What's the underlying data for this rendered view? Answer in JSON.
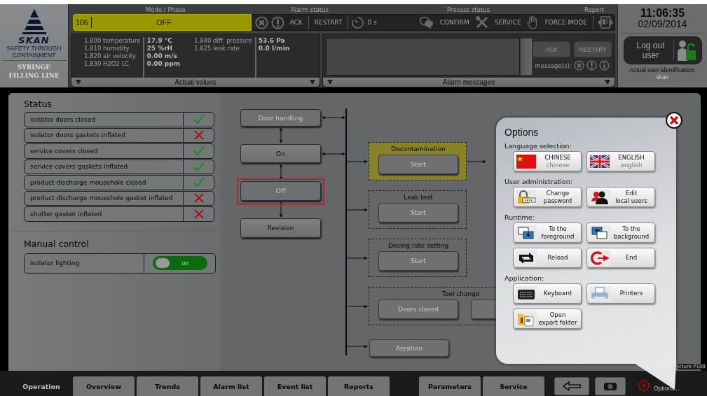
{
  "logo": {
    "brand": "SKAN",
    "tagline": "SAFETY THROUGH CONTAINMENT",
    "line_name": [
      "SYRINGE",
      "FILLING LINE"
    ]
  },
  "header": {
    "mode_phase": {
      "label": "Mode / Phase",
      "code": "106",
      "value": "OFF"
    },
    "alarm_status": {
      "label": "Alarm status",
      "ack": "ACK",
      "restart": "RESTART",
      "timer": "0 s"
    },
    "process_status": {
      "label": "Process status",
      "confirm": "CONFIRM",
      "service": "SERVICE",
      "force_mode": "FORCE MODE"
    },
    "report": {
      "label": "Report"
    }
  },
  "actual_values": {
    "title": "Actual values",
    "groups": [
      [
        {
          "code": "1.800",
          "name": "temperature",
          "value": "17.9 °C"
        },
        {
          "code": "1.810",
          "name": "humidity",
          "value": "25 %rH"
        },
        {
          "code": "1.820",
          "name": "air velocity",
          "value": "0.00 m/s"
        },
        {
          "code": "1.830",
          "name": "H2O2 LC",
          "value": "0.00 ppm"
        }
      ],
      [
        {
          "code": "1.840",
          "name": "diff. pressure",
          "value": "53.6 Pa"
        },
        {
          "code": "1.825",
          "name": "leak rate",
          "value": "0.0 l/min"
        }
      ]
    ]
  },
  "alarm_messages": {
    "title": "Alarm messages",
    "ack": "ACK",
    "restart": "RESTART",
    "count_label": "message(s):"
  },
  "clock": {
    "time": "11:06:35",
    "date": "02/09/2014"
  },
  "user": {
    "logout": "Log out user",
    "id_label": "Actual user identification:",
    "name": "skan"
  },
  "status": {
    "title": "Status",
    "items": [
      {
        "label": "isolator doors closed",
        "ok": true
      },
      {
        "label": "isolator doors gaskets inflated",
        "ok": false
      },
      {
        "label": "service covers closed",
        "ok": true
      },
      {
        "label": "service covers gaskets inflated",
        "ok": true
      },
      {
        "label": "product discharge mousehole closed",
        "ok": true
      },
      {
        "label": "product discharge mousehole gasket inflated",
        "ok": false
      },
      {
        "label": "shutter gasket inflated",
        "ok": false
      }
    ]
  },
  "manual_control": {
    "title": "Manual control",
    "items": [
      {
        "label": "isolator lighting",
        "on": true,
        "state": "on"
      }
    ]
  },
  "diagram": {
    "modes": [
      {
        "label": "Door handling",
        "disabled": true,
        "selected": false
      },
      {
        "label": "On",
        "disabled": false,
        "selected": false
      },
      {
        "label": "Off",
        "disabled": true,
        "selected": true
      },
      {
        "label": "Revision",
        "disabled": false,
        "selected": false
      }
    ],
    "phases": [
      {
        "kind": "group",
        "title": "Decontamination",
        "active": true,
        "buttons": [
          {
            "label": "Start",
            "disabled": true
          }
        ]
      },
      {
        "kind": "group",
        "title": "Leak test",
        "active": false,
        "buttons": [
          {
            "label": "Start",
            "disabled": true
          }
        ]
      },
      {
        "kind": "group",
        "title": "Dosing rate setting",
        "active": false,
        "buttons": [
          {
            "label": "Start",
            "disabled": true
          }
        ]
      },
      {
        "kind": "group",
        "title": "Tool change",
        "active": false,
        "buttons": [
          {
            "label": "Doors closed",
            "disabled": true
          },
          {
            "disabled": true
          }
        ]
      },
      {
        "kind": "step",
        "label": "Aeration",
        "disabled": true
      }
    ]
  },
  "options": {
    "title": "Options",
    "sections": [
      {
        "title": "Language selection:",
        "buttons": [
          {
            "lines": [
              "CHINESE"
            ],
            "sublabel": "chinese"
          },
          {
            "lines": [
              "ENGLISH"
            ],
            "sublabel": "english"
          }
        ]
      },
      {
        "title": "User administration:",
        "buttons": [
          {
            "lines": [
              "Change",
              "password"
            ]
          },
          {
            "lines": [
              "Edit",
              "local users"
            ]
          }
        ]
      },
      {
        "title": "Runtime:",
        "buttons": [
          {
            "lines": [
              "To the",
              "foreground"
            ]
          },
          {
            "lines": [
              "To the",
              "background"
            ]
          },
          {
            "lines": [
              "Reload"
            ]
          },
          {
            "lines": [
              "End"
            ]
          }
        ]
      },
      {
        "title": "Application:",
        "buttons": [
          {
            "lines": [
              "Keyboard"
            ]
          },
          {
            "lines": [
              "Printers"
            ]
          },
          {
            "lines": [
              "Open",
              "export folder"
            ]
          }
        ]
      }
    ]
  },
  "screen_id": "icture P100",
  "nav": {
    "tabs": [
      {
        "label": "Operation",
        "selected": true
      },
      {
        "label": "Overview",
        "selected": false
      },
      {
        "label": "Trends",
        "selected": false
      },
      {
        "label": "Alarm list",
        "selected": false
      },
      {
        "label": "Event list",
        "selected": false
      },
      {
        "label": "Reports",
        "selected": false
      },
      {
        "label": "Parameters",
        "selected": false
      },
      {
        "label": "Service",
        "selected": false
      }
    ],
    "options_label": "Options..."
  }
}
